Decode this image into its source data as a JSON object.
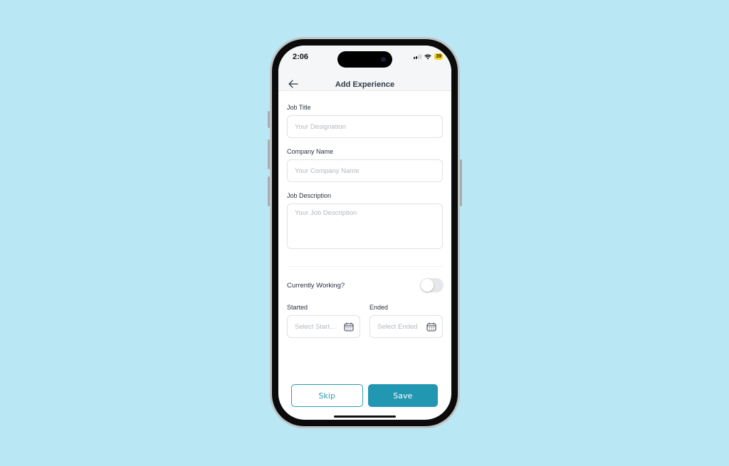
{
  "status_bar": {
    "time": "2:06",
    "battery": "39",
    "icons": [
      "cellular-signal-icon",
      "wifi-icon",
      "battery-icon"
    ]
  },
  "header": {
    "back_icon": "arrow-left-icon",
    "title": "Add Experience"
  },
  "form": {
    "job_title": {
      "label": "Job Title",
      "placeholder": "Your Designation",
      "value": ""
    },
    "company_name": {
      "label": "Company Name",
      "placeholder": "Your Company Name",
      "value": ""
    },
    "job_description": {
      "label": "Job Description",
      "placeholder": "Your Job Description",
      "value": ""
    },
    "currently_working": {
      "label": "Currently Working?",
      "checked": false
    },
    "started": {
      "label": "Started",
      "placeholder": "Select Start...",
      "icon": "calendar-icon"
    },
    "ended": {
      "label": "Ended",
      "placeholder": "Select Ended",
      "icon": "calendar-icon"
    }
  },
  "actions": {
    "skip_label": "Skip",
    "save_label": "Save"
  },
  "colors": {
    "background": "#b9e8f4",
    "primary": "#2197b2",
    "skip_border": "#2a9cb8"
  }
}
